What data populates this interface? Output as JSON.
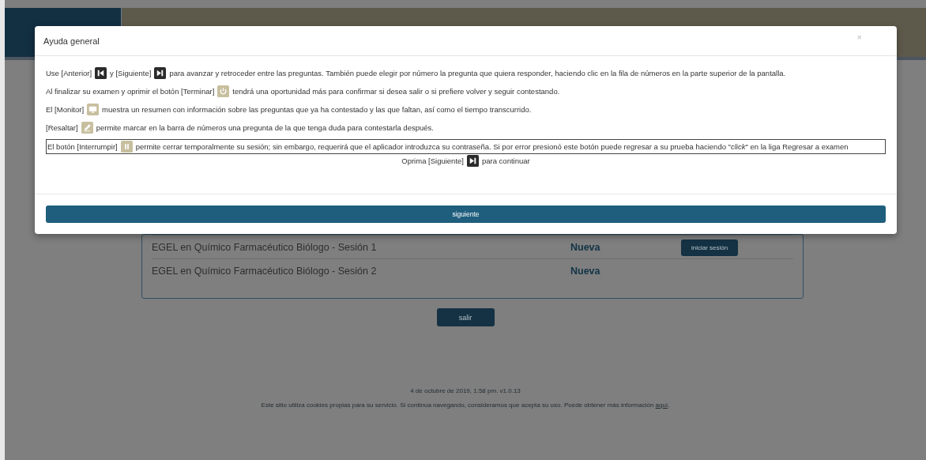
{
  "exams": [
    {
      "name": "EGEL en Químico Farmacéutico Biólogo - Sesión 1",
      "status": "Nueva",
      "action": "iniciar sesión"
    },
    {
      "name": "EGEL en Químico Farmacéutico Biólogo - Sesión 2",
      "status": "Nueva"
    }
  ],
  "exit_button": "salir",
  "footer": {
    "timestamp": "4 de octubre de 2019, 1:58 pm. v1.0.13",
    "cookie_notice": "Este sitio utiliza cookies propias para su servicio. Si continua navegando, consideramos que acepta su uso. Puede obtener más información",
    "cookie_link": "aquí",
    "cookie_end": "."
  },
  "dialog": {
    "title": "Ayuda general",
    "close": "×",
    "paragraphs": [
      {
        "kind": "help",
        "focused": false,
        "parts": [
          {
            "kind": "text",
            "text": "Use [Anterior]"
          },
          {
            "kind": "icon"
          },
          {
            "kind": "text",
            "text": "y [Siguiente]"
          },
          {
            "kind": "icon"
          },
          {
            "kind": "text",
            "text": "para avanzar y retroceder entre las preguntas. También puede elegir por número la pregunta que quiera responder, haciendo clic en la fila de números en la parte superior de la pantalla."
          }
        ]
      },
      {
        "kind": "help",
        "focused": false,
        "parts": [
          {
            "kind": "text",
            "text": "Al finalizar su examen y oprimir el botón [Terminar]"
          },
          {
            "kind": "icon"
          },
          {
            "kind": "text",
            "text": "tendrá una oportunidad más para confirmar si desea salir o si prefiere volver y seguir contestando."
          }
        ]
      },
      {
        "kind": "help",
        "focused": false,
        "parts": [
          {
            "kind": "text",
            "text": "El [Monitor]"
          },
          {
            "kind": "icon"
          },
          {
            "kind": "text",
            "text": "muestra un resumen con información sobre las preguntas que ya ha contestado y las que faltan, así como el tiempo transcurrido."
          }
        ]
      },
      {
        "kind": "help",
        "focused": false,
        "parts": [
          {
            "kind": "text",
            "text": "[Resaltar]"
          },
          {
            "kind": "icon"
          },
          {
            "kind": "text",
            "text": "permite marcar en la barra de números una pregunta de la que tenga duda para contestarla después."
          }
        ]
      },
      {
        "kind": "help",
        "focused": true,
        "parts": [
          {
            "kind": "text",
            "text": "El botón [Interrumpir]"
          },
          {
            "kind": "icon"
          },
          {
            "kind": "text",
            "text": "permite cerrar temporalmente su sesión; sin embargo, requerirá que el aplicador introduzca su contraseña. Si por error presionó este botón puede regresar a su prueba haciendo \"*click*\" en la liga Regresar a examen"
          }
        ]
      },
      {
        "kind": "prompt",
        "focused": false,
        "parts": [
          {
            "kind": "text",
            "text": "Oprima [Siguiente]"
          },
          {
            "kind": "icon"
          },
          {
            "kind": "text",
            "text": "para continuar"
          }
        ]
      }
    ],
    "button": "siguiente"
  }
}
